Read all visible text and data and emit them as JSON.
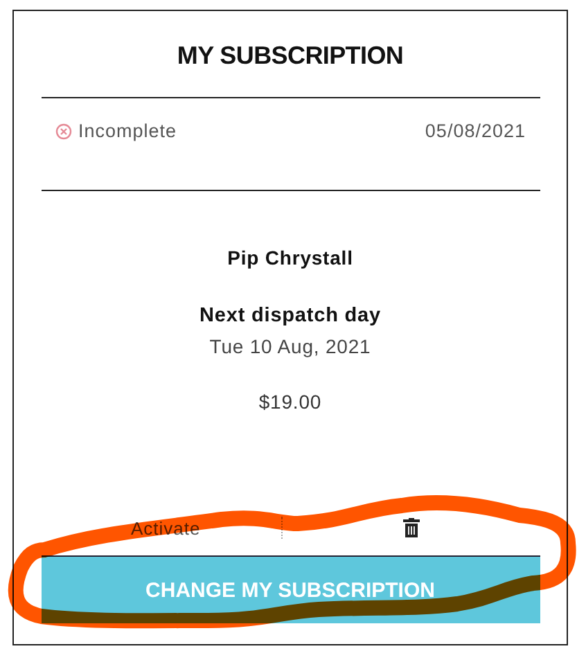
{
  "title": "MY SUBSCRIPTION",
  "status": {
    "label": "Incomplete",
    "kind": "incomplete",
    "date": "05/08/2021"
  },
  "customer": "Pip Chrystall",
  "dispatch": {
    "label": "Next dispatch day",
    "date": "Tue 10 Aug, 2021"
  },
  "price": "$19.00",
  "actions": {
    "activate": "Activate"
  },
  "button": "CHANGE MY SUBSCRIPTION"
}
